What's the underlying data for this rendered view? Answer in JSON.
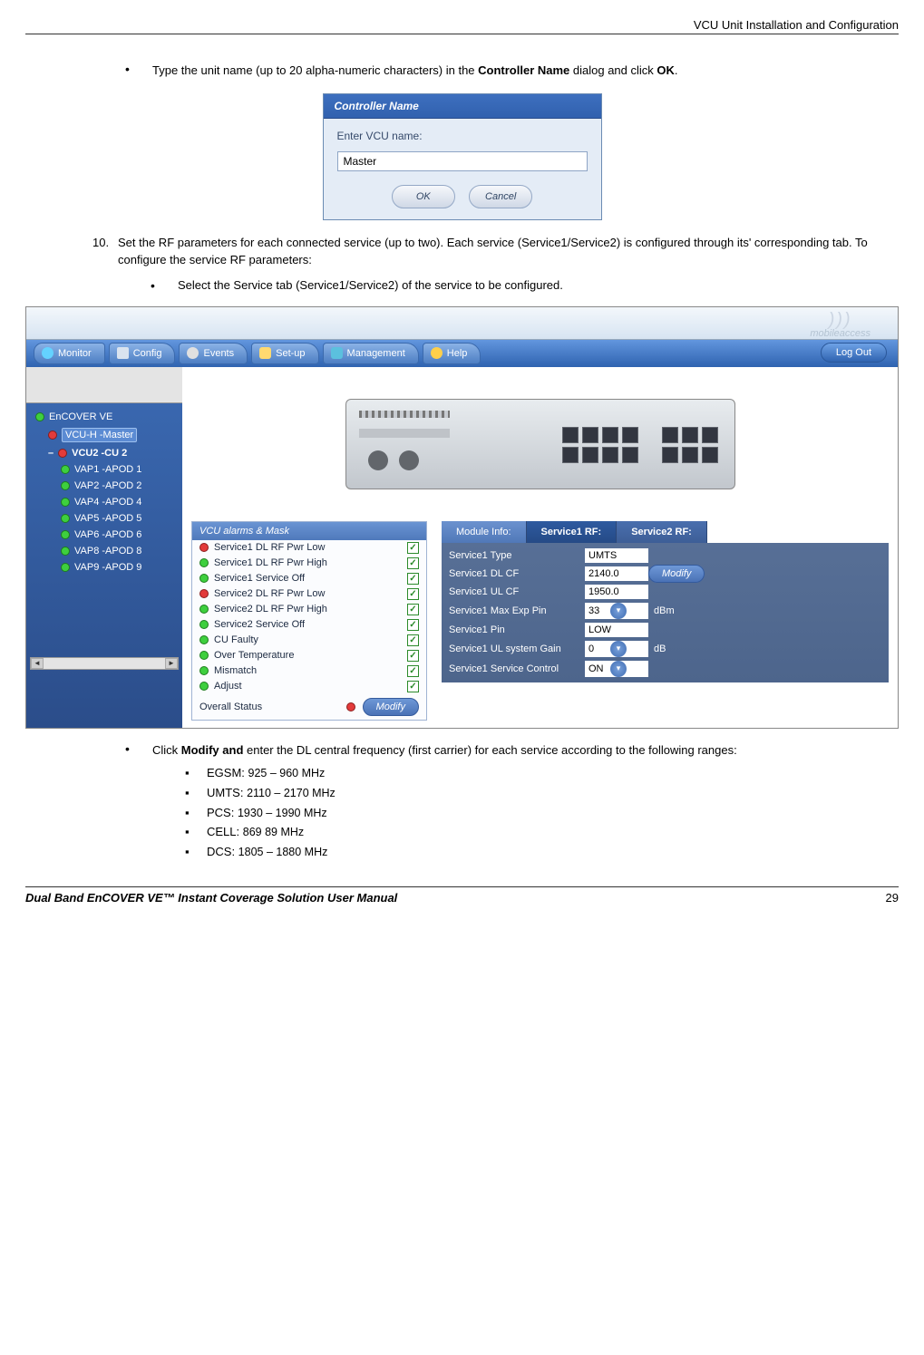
{
  "header": {
    "right_title": "VCU Unit Installation and Configuration"
  },
  "step9_bullet": {
    "before": "Type the unit name (up to 20 alpha-numeric characters) in the ",
    "strong1": "Controller Name",
    "mid": " dialog and click ",
    "strong2": "OK",
    "after": "."
  },
  "dialog": {
    "title": "Controller Name",
    "label": "Enter VCU name:",
    "value": "Master",
    "ok": "OK",
    "cancel": "Cancel"
  },
  "step10": {
    "num": "10.",
    "text": "Set the RF parameters for each connected service (up to two). Each service (Service1/Service2) is configured through its' corresponding tab. To configure the service RF parameters:",
    "sub_bullet": "Select the Service tab (Service1/Service2) of the service to be configured."
  },
  "app": {
    "logo": "mobileaccess",
    "nav": {
      "monitor": "Monitor",
      "config": "Config",
      "events": "Events",
      "setup": "Set-up",
      "management": "Management",
      "help": "Help",
      "logout": "Log Out"
    },
    "tree": {
      "root": "EnCOVER VE",
      "n1": "VCU-H -Master",
      "n2": "VCU2 -CU 2",
      "leaves": [
        "VAP1 -APOD 1",
        "VAP2 -APOD 2",
        "VAP4 -APOD 4",
        "VAP5 -APOD 5",
        "VAP6 -APOD 6",
        "VAP8 -APOD 8",
        "VAP9 -APOD 9"
      ]
    },
    "alarms": {
      "title": "VCU alarms & Mask",
      "items": [
        {
          "led": "red",
          "name": "Service1 DL RF Pwr Low"
        },
        {
          "led": "green",
          "name": "Service1 DL RF Pwr High"
        },
        {
          "led": "green",
          "name": "Service1 Service Off"
        },
        {
          "led": "red",
          "name": "Service2 DL RF Pwr Low"
        },
        {
          "led": "green",
          "name": "Service2 DL RF Pwr High"
        },
        {
          "led": "green",
          "name": "Service2 Service Off"
        },
        {
          "led": "green",
          "name": "CU Faulty"
        },
        {
          "led": "green",
          "name": "Over Temperature"
        },
        {
          "led": "green",
          "name": "Mismatch"
        },
        {
          "led": "green",
          "name": "Adjust"
        }
      ],
      "overall_label": "Overall Status",
      "modify": "Modify"
    },
    "svc": {
      "tab_module": "Module Info:",
      "tab_s1": "Service1 RF:",
      "tab_s2": "Service2 RF:",
      "rows": {
        "type_lbl": "Service1 Type",
        "type_val": "UMTS",
        "dlcf_lbl": "Service1 DL CF",
        "dlcf_val": "2140.0",
        "ulcf_lbl": "Service1 UL CF",
        "ulcf_val": "1950.0",
        "maxpin_lbl": "Service1 Max Exp Pin",
        "maxpin_val": "33",
        "maxpin_unit": "dBm",
        "pin_lbl": "Service1 Pin",
        "pin_val": "LOW",
        "gain_lbl": "Service1 UL system Gain",
        "gain_val": "0",
        "gain_unit": "dB",
        "ctrl_lbl": "Service1 Service Control",
        "ctrl_val": "ON"
      },
      "modify": "Modify"
    }
  },
  "post_bullet": {
    "before": "Click ",
    "strong": "Modify and",
    "after": " enter the DL central frequency (first carrier) for each service according to the following ranges:"
  },
  "ranges": [
    {
      "lbl": "EGSM: ",
      "val": "925 – 960  MHz"
    },
    {
      "lbl": "UMTS: ",
      "val": "2110 – 2170  MHz"
    },
    {
      "lbl": "PCS: ",
      "val": "1930 – 1990  MHz"
    },
    {
      "lbl": "CELL: ",
      "val": "869  89  MHz"
    },
    {
      "lbl": "DCS: ",
      "val": "1805 – 1880  MHz"
    }
  ],
  "footer": {
    "left": "Dual Band EnCOVER VE™ Instant Coverage Solution User Manual",
    "right": "29"
  }
}
